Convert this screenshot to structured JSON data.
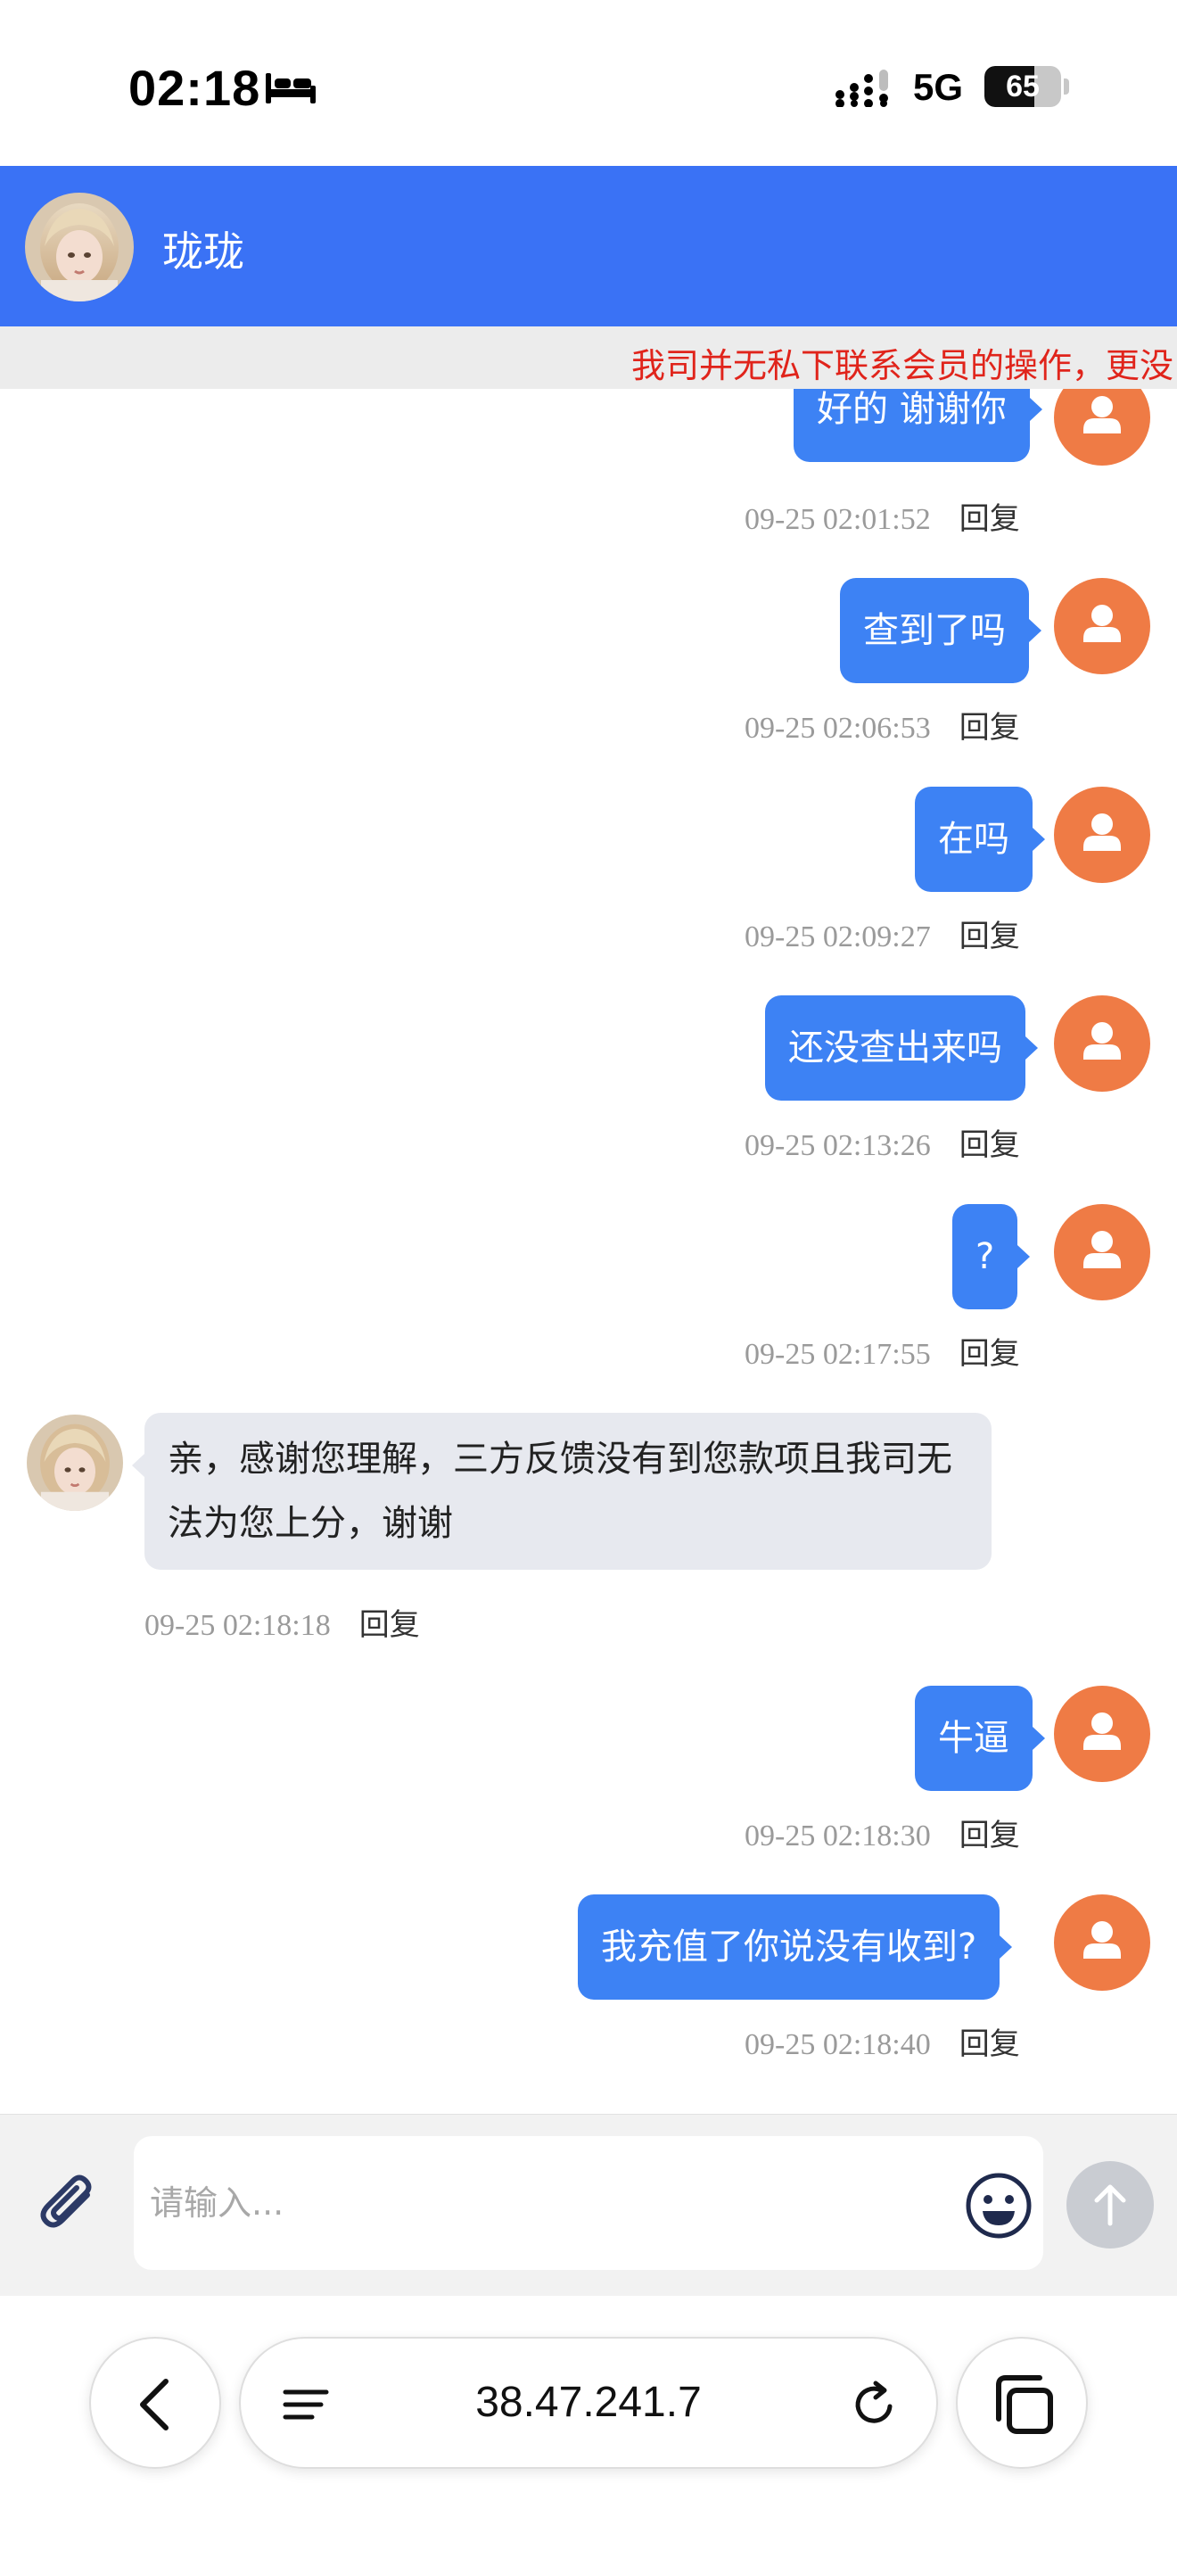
{
  "status_bar": {
    "time": "02:18",
    "network": "5G",
    "battery": "65",
    "battery_level": 0.65
  },
  "header": {
    "title": "珑珑"
  },
  "notice": {
    "text": "我司并无私下联系会员的操作，更没"
  },
  "messages": [
    {
      "text": "好的 谢谢你",
      "time": "09-25 02:01:52",
      "reply": "回复"
    },
    {
      "text": "查到了吗",
      "time": "09-25 02:06:53",
      "reply": "回复"
    },
    {
      "text": "在吗",
      "time": "09-25 02:09:27",
      "reply": "回复"
    },
    {
      "text": "还没查出来吗",
      "time": "09-25 02:13:26",
      "reply": "回复"
    },
    {
      "text": "?",
      "time": "09-25 02:17:55",
      "reply": "回复"
    },
    {
      "text": "亲，感谢您理解，三方反馈没有到您款项且我司无法为您上分，谢谢",
      "time": "09-25 02:18:18",
      "reply": "回复"
    },
    {
      "text": "牛逼",
      "time": "09-25 02:18:30",
      "reply": "回复"
    },
    {
      "text": "我充值了你说没有收到?",
      "time": "09-25 02:18:40",
      "reply": "回复"
    }
  ],
  "composer": {
    "placeholder": "请输入..."
  },
  "browser": {
    "url": "38.47.241.7"
  },
  "colors": {
    "header": "#3a72f5",
    "bubble_out": "#3d82f4",
    "bubble_in": "#e7e9ef",
    "user_avatar": "#ef7b45",
    "notice": "#e0241b"
  }
}
